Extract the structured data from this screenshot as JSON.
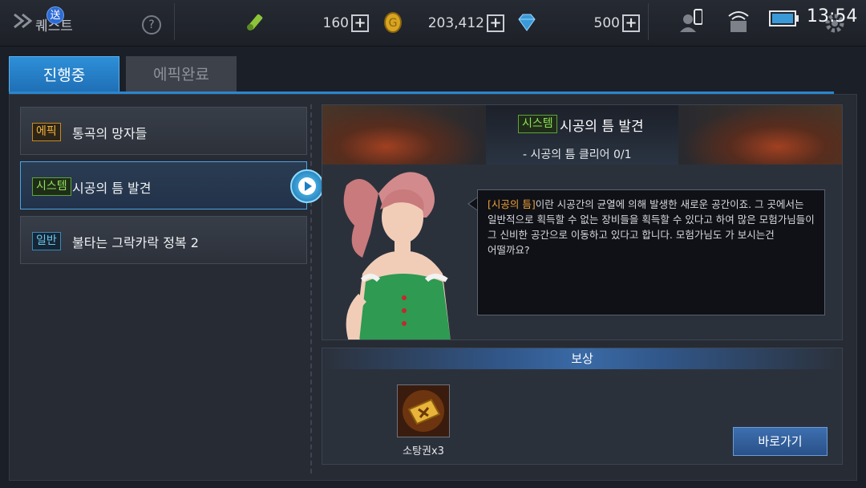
{
  "topbar": {
    "notification_count": "送",
    "title": "퀘스트",
    "help_symbol": "?",
    "resources": [
      {
        "icon": "wrench-icon",
        "value": "160",
        "plus": "+"
      },
      {
        "icon": "gold-coin-icon",
        "value": "203,412",
        "plus": "+"
      },
      {
        "icon": "diamond-icon",
        "value": "500",
        "plus": "+"
      }
    ],
    "clock": "13:54"
  },
  "tabs": [
    {
      "label": "진행중",
      "active": true
    },
    {
      "label": "에픽완료",
      "active": false
    }
  ],
  "quests": [
    {
      "tag": "에픽",
      "tag_type": "epic",
      "name": "통곡의 망자들"
    },
    {
      "tag": "시스템",
      "tag_type": "system",
      "name": "시공의 틈 발견"
    },
    {
      "tag": "일반",
      "tag_type": "normal",
      "name": "불타는 그락카락 정복 2"
    }
  ],
  "detail": {
    "tag": "시스템",
    "title": "시공의 틈 발견",
    "subtitle": "- 시공의 틈 클리어 0/1",
    "dialog_highlight": "[시공의 틈]",
    "dialog_text": "이란 시공간의 균열에 의해 발생한 새로운 공간이죠. 그 곳에서는 일반적으로 획득할 수 없는 장비들을 획득할 수 있다고 하여 많은 모험가님들이 그 신비한 공간으로 이동하고 있다고 합니다. 모험가님도 가 보시는건 어떨까요?"
  },
  "reward": {
    "header": "보상",
    "item_label": "소탕권x3",
    "goto_button": "바로가기"
  },
  "colors": {
    "accent": "#2a86cf",
    "epic": "#f0b23a",
    "system": "#8fe05a",
    "normal": "#6cc6f0",
    "highlight": "#f0a03a"
  }
}
